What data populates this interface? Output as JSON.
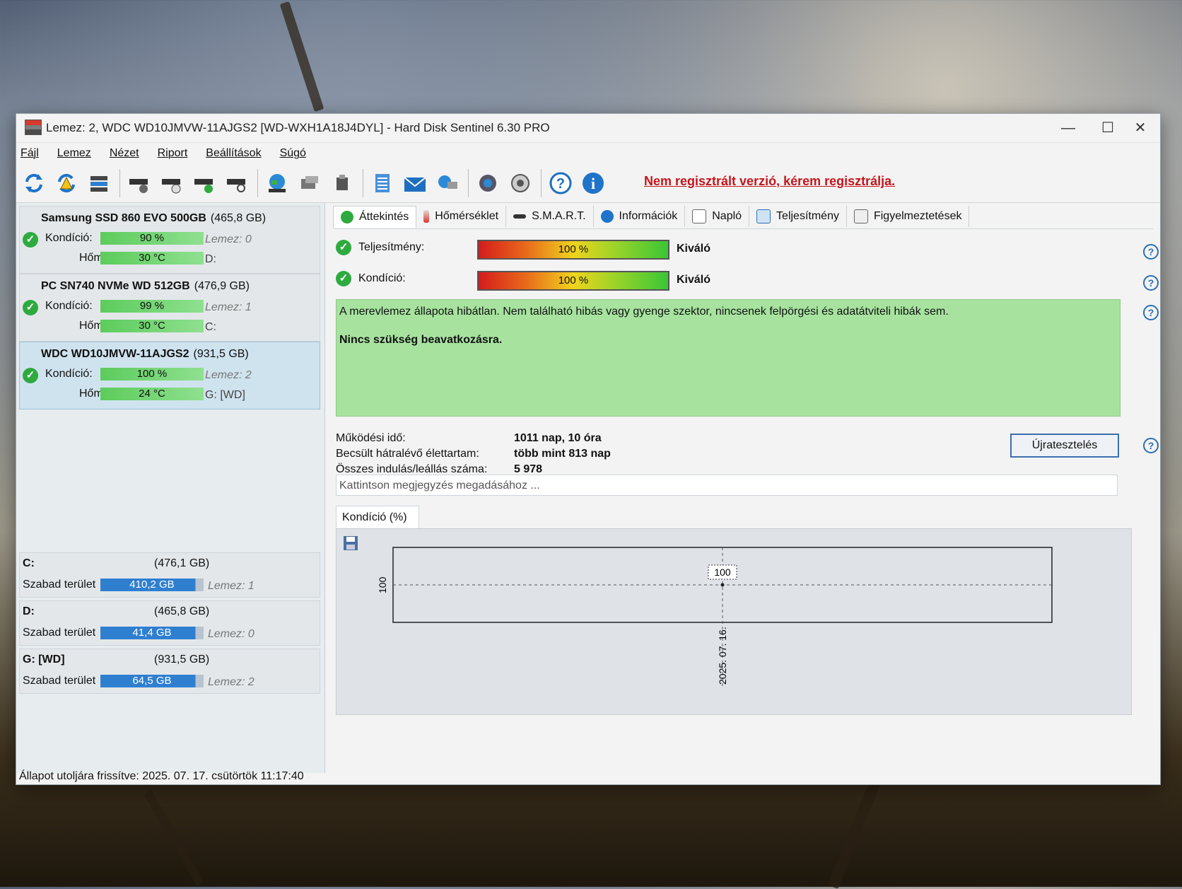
{
  "window": {
    "title": "Lemez: 2, WDC WD10JMVW-11AJGS2 [WD-WXH1A18J4DYL]  -  Hard Disk Sentinel 6.30 PRO",
    "minimize": "—",
    "maximize": "☐",
    "close": "✕"
  },
  "menu": [
    "Fájl",
    "Lemez",
    "Nézet",
    "Riport",
    "Beállítások",
    "Súgó"
  ],
  "toolbar": {
    "register_link": "Nem regisztrált verzió, kérem regisztrálja."
  },
  "disks": [
    {
      "name": "Samsung SSD 860 EVO 500GB",
      "size": "(465,8 GB)",
      "health_label": "Kondíció:",
      "health": "90 %",
      "health_pct": 90,
      "temp_label": "Hőm.:",
      "temp": "30 °C",
      "disk_label": "Lemez: 0",
      "drive": "D:"
    },
    {
      "name": "PC SN740 NVMe WD 512GB",
      "size": "(476,9 GB)",
      "health_label": "Kondíció:",
      "health": "99 %",
      "health_pct": 99,
      "temp_label": "Hőm.:",
      "temp": "30 °C",
      "disk_label": "Lemez: 1",
      "drive": "C:"
    },
    {
      "name": "WDC WD10JMVW-11AJGS2",
      "size": "(931,5 GB)",
      "health_label": "Kondíció:",
      "health": "100 %",
      "health_pct": 100,
      "temp_label": "Hőm.:",
      "temp": "24 °C",
      "disk_label": "Lemez: 2",
      "drive": "G: [WD]"
    }
  ],
  "partitions": [
    {
      "name": "C:",
      "size": "(476,1 GB)",
      "free_label": "Szabad terület",
      "free": "410,2 GB",
      "disk_label": "Lemez: 1"
    },
    {
      "name": "D:",
      "size": "(465,8 GB)",
      "free_label": "Szabad terület",
      "free": "41,4 GB",
      "disk_label": "Lemez: 0"
    },
    {
      "name": "G: [WD]",
      "size": "(931,5 GB)",
      "free_label": "Szabad terület",
      "free": "64,5 GB",
      "disk_label": "Lemez: 2"
    }
  ],
  "tabs": [
    "Áttekintés",
    "Hőmérséklet",
    "S.M.A.R.T.",
    "Információk",
    "Napló",
    "Teljesítmény",
    "Figyelmeztetések"
  ],
  "overview": {
    "performance_label": "Teljesítmény:",
    "performance_value": "100 %",
    "performance_status": "Kiváló",
    "health_label": "Kondíció:",
    "health_value": "100 %",
    "health_status": "Kiváló",
    "status_text": "A merevlemez állapota hibátlan. Nem található hibás vagy gyenge szektor, nincsenek felpörgési és adatátviteli hibák sem.",
    "status_action": "Nincs szükség beavatkozásra.",
    "power_on_label": "Működési idő:",
    "power_on_value": "1011 nap, 10 óra",
    "lifetime_label": "Becsült hátralévő élettartam:",
    "lifetime_value": "több mint 813 nap",
    "start_stop_label": "Összes indulás/leállás száma:",
    "start_stop_value": "5 978",
    "retest_button": "Újratesztelés",
    "note_placeholder": "Kattintson megjegyzés megadásához ...",
    "chart_tab": "Kondíció  (%)"
  },
  "chart_data": {
    "type": "line",
    "x": [
      "2025. 07. 16."
    ],
    "series": [
      {
        "values": [
          100
        ]
      }
    ],
    "y_tick_labels": [
      "100"
    ],
    "data_labels": [
      "100"
    ],
    "grid": true
  },
  "statusbar": {
    "text": "Állapot utoljára frissítve: 2025. 07. 17. csütörtök 11:17:40"
  },
  "colors": {
    "status_green": "#a7e39f",
    "register_red": "#c4161c",
    "ok_green": "#2eaa3f",
    "free_space_blue": "#2f7fd0"
  },
  "icons": [
    "refresh-icon",
    "refresh-warning-icon",
    "disk-list-icon",
    "disk-info-icon",
    "disk-timer-icon",
    "disk-ok-icon",
    "disk-search-icon",
    "globe-icon",
    "network-disk-icon",
    "usb-disk-icon",
    "report-icon",
    "email-icon",
    "remote-icon",
    "settings-icon",
    "sound-icon",
    "help-icon",
    "info-icon"
  ]
}
